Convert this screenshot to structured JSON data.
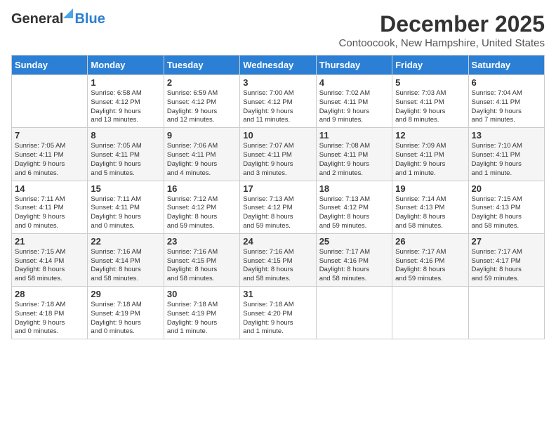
{
  "header": {
    "logo_general": "General",
    "logo_blue": "Blue",
    "month_title": "December 2025",
    "location": "Contoocook, New Hampshire, United States"
  },
  "days_of_week": [
    "Sunday",
    "Monday",
    "Tuesday",
    "Wednesday",
    "Thursday",
    "Friday",
    "Saturday"
  ],
  "weeks": [
    [
      {
        "day": "",
        "info": ""
      },
      {
        "day": "1",
        "info": "Sunrise: 6:58 AM\nSunset: 4:12 PM\nDaylight: 9 hours\nand 13 minutes."
      },
      {
        "day": "2",
        "info": "Sunrise: 6:59 AM\nSunset: 4:12 PM\nDaylight: 9 hours\nand 12 minutes."
      },
      {
        "day": "3",
        "info": "Sunrise: 7:00 AM\nSunset: 4:12 PM\nDaylight: 9 hours\nand 11 minutes."
      },
      {
        "day": "4",
        "info": "Sunrise: 7:02 AM\nSunset: 4:11 PM\nDaylight: 9 hours\nand 9 minutes."
      },
      {
        "day": "5",
        "info": "Sunrise: 7:03 AM\nSunset: 4:11 PM\nDaylight: 9 hours\nand 8 minutes."
      },
      {
        "day": "6",
        "info": "Sunrise: 7:04 AM\nSunset: 4:11 PM\nDaylight: 9 hours\nand 7 minutes."
      }
    ],
    [
      {
        "day": "7",
        "info": "Sunrise: 7:05 AM\nSunset: 4:11 PM\nDaylight: 9 hours\nand 6 minutes."
      },
      {
        "day": "8",
        "info": "Sunrise: 7:05 AM\nSunset: 4:11 PM\nDaylight: 9 hours\nand 5 minutes."
      },
      {
        "day": "9",
        "info": "Sunrise: 7:06 AM\nSunset: 4:11 PM\nDaylight: 9 hours\nand 4 minutes."
      },
      {
        "day": "10",
        "info": "Sunrise: 7:07 AM\nSunset: 4:11 PM\nDaylight: 9 hours\nand 3 minutes."
      },
      {
        "day": "11",
        "info": "Sunrise: 7:08 AM\nSunset: 4:11 PM\nDaylight: 9 hours\nand 2 minutes."
      },
      {
        "day": "12",
        "info": "Sunrise: 7:09 AM\nSunset: 4:11 PM\nDaylight: 9 hours\nand 1 minute."
      },
      {
        "day": "13",
        "info": "Sunrise: 7:10 AM\nSunset: 4:11 PM\nDaylight: 9 hours\nand 1 minute."
      }
    ],
    [
      {
        "day": "14",
        "info": "Sunrise: 7:11 AM\nSunset: 4:11 PM\nDaylight: 9 hours\nand 0 minutes."
      },
      {
        "day": "15",
        "info": "Sunrise: 7:11 AM\nSunset: 4:11 PM\nDaylight: 9 hours\nand 0 minutes."
      },
      {
        "day": "16",
        "info": "Sunrise: 7:12 AM\nSunset: 4:12 PM\nDaylight: 8 hours\nand 59 minutes."
      },
      {
        "day": "17",
        "info": "Sunrise: 7:13 AM\nSunset: 4:12 PM\nDaylight: 8 hours\nand 59 minutes."
      },
      {
        "day": "18",
        "info": "Sunrise: 7:13 AM\nSunset: 4:12 PM\nDaylight: 8 hours\nand 59 minutes."
      },
      {
        "day": "19",
        "info": "Sunrise: 7:14 AM\nSunset: 4:13 PM\nDaylight: 8 hours\nand 58 minutes."
      },
      {
        "day": "20",
        "info": "Sunrise: 7:15 AM\nSunset: 4:13 PM\nDaylight: 8 hours\nand 58 minutes."
      }
    ],
    [
      {
        "day": "21",
        "info": "Sunrise: 7:15 AM\nSunset: 4:14 PM\nDaylight: 8 hours\nand 58 minutes."
      },
      {
        "day": "22",
        "info": "Sunrise: 7:16 AM\nSunset: 4:14 PM\nDaylight: 8 hours\nand 58 minutes."
      },
      {
        "day": "23",
        "info": "Sunrise: 7:16 AM\nSunset: 4:15 PM\nDaylight: 8 hours\nand 58 minutes."
      },
      {
        "day": "24",
        "info": "Sunrise: 7:16 AM\nSunset: 4:15 PM\nDaylight: 8 hours\nand 58 minutes."
      },
      {
        "day": "25",
        "info": "Sunrise: 7:17 AM\nSunset: 4:16 PM\nDaylight: 8 hours\nand 58 minutes."
      },
      {
        "day": "26",
        "info": "Sunrise: 7:17 AM\nSunset: 4:16 PM\nDaylight: 8 hours\nand 59 minutes."
      },
      {
        "day": "27",
        "info": "Sunrise: 7:17 AM\nSunset: 4:17 PM\nDaylight: 8 hours\nand 59 minutes."
      }
    ],
    [
      {
        "day": "28",
        "info": "Sunrise: 7:18 AM\nSunset: 4:18 PM\nDaylight: 9 hours\nand 0 minutes."
      },
      {
        "day": "29",
        "info": "Sunrise: 7:18 AM\nSunset: 4:19 PM\nDaylight: 9 hours\nand 0 minutes."
      },
      {
        "day": "30",
        "info": "Sunrise: 7:18 AM\nSunset: 4:19 PM\nDaylight: 9 hours\nand 1 minute."
      },
      {
        "day": "31",
        "info": "Sunrise: 7:18 AM\nSunset: 4:20 PM\nDaylight: 9 hours\nand 1 minute."
      },
      {
        "day": "",
        "info": ""
      },
      {
        "day": "",
        "info": ""
      },
      {
        "day": "",
        "info": ""
      }
    ]
  ]
}
